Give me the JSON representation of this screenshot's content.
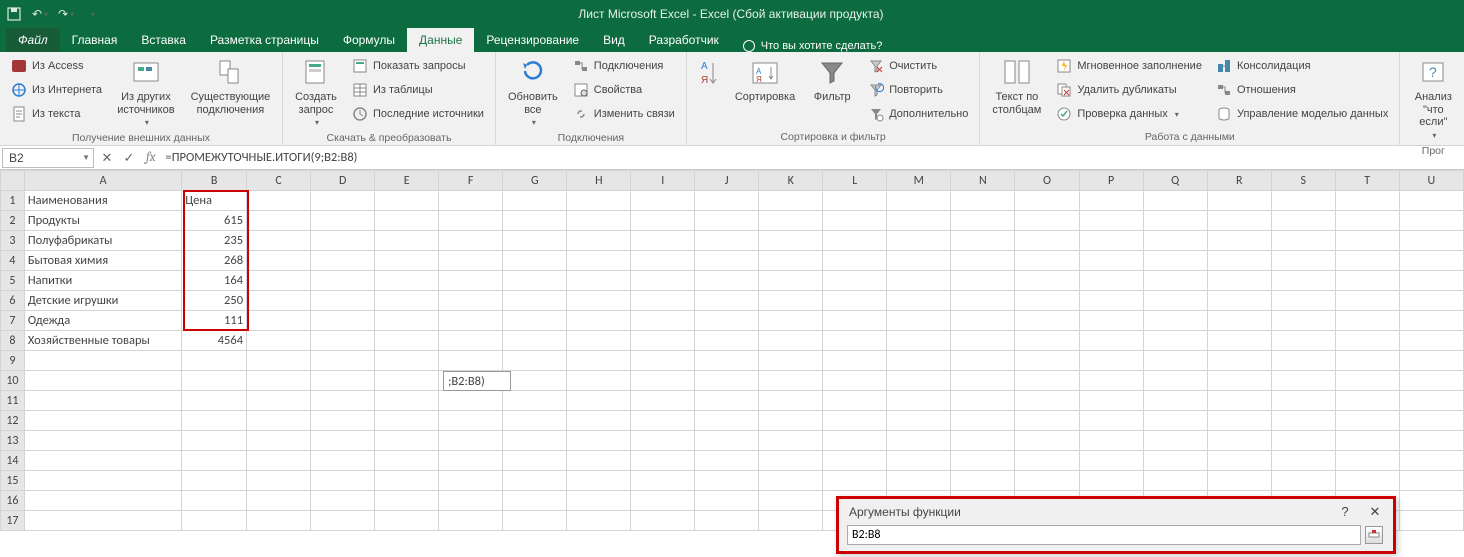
{
  "titlebar": {
    "title": "Лист Microsoft Excel - Excel (Сбой активации продукта)"
  },
  "tabs": {
    "file": "Файл",
    "items": [
      "Главная",
      "Вставка",
      "Разметка страницы",
      "Формулы",
      "Данные",
      "Рецензирование",
      "Вид",
      "Разработчик"
    ],
    "active_index": 4,
    "tell_me": "Что вы хотите сделать?"
  },
  "ribbon": {
    "ext": {
      "access": "Из Access",
      "web": "Из Интернета",
      "text": "Из текста",
      "other": "Из других источников",
      "existing": "Существующие подключения",
      "group": "Получение внешних данных"
    },
    "get": {
      "new": "Создать запрос",
      "show": "Показать запросы",
      "table": "Из таблицы",
      "recent": "Последние источники",
      "group": "Скачать & преобразовать"
    },
    "conn": {
      "refresh": "Обновить все",
      "conn": "Подключения",
      "props": "Свойства",
      "edit": "Изменить связи",
      "group": "Подключения"
    },
    "sort": {
      "sort": "Сортировка",
      "filter": "Фильтр",
      "clear": "Очистить",
      "reapply": "Повторить",
      "adv": "Дополнительно",
      "group": "Сортировка и фильтр"
    },
    "tools": {
      "ttc": "Текст по столбцам",
      "flash": "Мгновенное заполнение",
      "dup": "Удалить дубликаты",
      "val": "Проверка данных",
      "cons": "Консолидация",
      "rel": "Отношения",
      "model": "Управление моделью данных",
      "group": "Работа с данными"
    },
    "forecast": {
      "what": "Анализ \"что если\"",
      "group": "Прог"
    }
  },
  "namebox": "B2",
  "formula": "=ПРОМЕЖУТОЧНЫЕ.ИТОГИ(9;B2:B8)",
  "columns": [
    "A",
    "B",
    "C",
    "D",
    "E",
    "F",
    "G",
    "H",
    "I",
    "J",
    "K",
    "L",
    "M",
    "N",
    "O",
    "P",
    "Q",
    "R",
    "S",
    "T",
    "U"
  ],
  "headers": {
    "a": "Наименования",
    "b": "Цена"
  },
  "rows": [
    {
      "a": "Продукты",
      "b": 615
    },
    {
      "a": "Полуфабрикаты",
      "b": 235
    },
    {
      "a": "Бытовая химия",
      "b": 268
    },
    {
      "a": "Напитки",
      "b": 164
    },
    {
      "a": "Детские игрушки",
      "b": 250
    },
    {
      "a": "Одежда",
      "b": 111
    },
    {
      "a": "Хозяйственные товары",
      "b": 4564
    }
  ],
  "cell_overlay": ";B2:B8)",
  "dialog": {
    "title": "Аргументы функции",
    "value": "B2:B8",
    "help": "?",
    "close": "✕"
  }
}
